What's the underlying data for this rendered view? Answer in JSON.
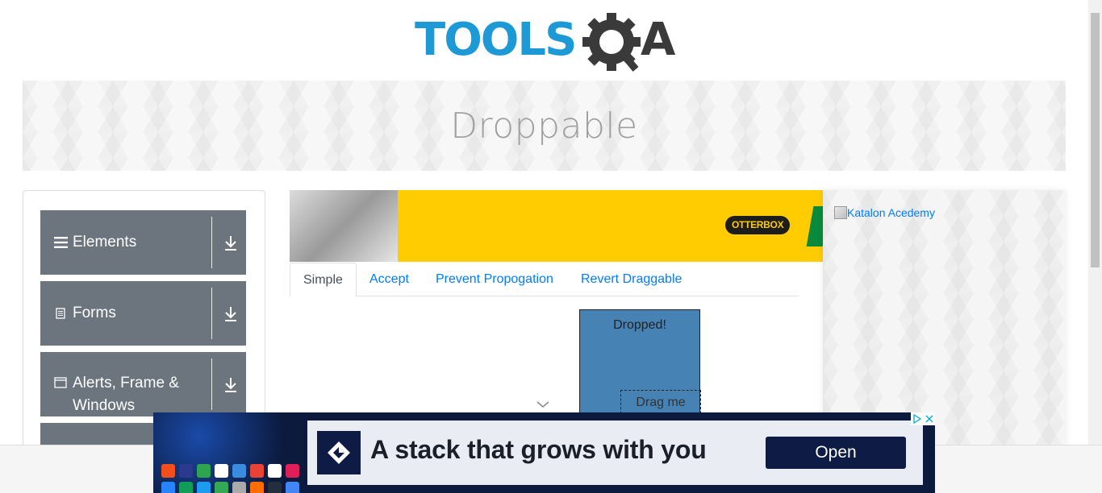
{
  "header": {
    "logo_alt": "TOOLSQA",
    "logo_text_tools": "TOOLS",
    "logo_text_qa": "A"
  },
  "banner": {
    "title": "Droppable"
  },
  "sidebar": {
    "groups": [
      {
        "label": "Elements",
        "icon": "hamburger-icon"
      },
      {
        "label": "Forms",
        "icon": "document-icon"
      },
      {
        "label_line1": "Alerts, Frame &",
        "label_line2": "Windows",
        "icon": "window-icon"
      }
    ]
  },
  "top_ad": {
    "brand": "OTTERBOX"
  },
  "tabs": [
    {
      "label": "Simple",
      "active": true
    },
    {
      "label": "Accept",
      "active": false
    },
    {
      "label": "Prevent Propogation",
      "active": false
    },
    {
      "label": "Revert Draggable",
      "active": false
    }
  ],
  "droppable": {
    "text": "Dropped!",
    "color": "#4682b4"
  },
  "draggable": {
    "text": "Drag me"
  },
  "right_ad": {
    "alt": "Katalon Acedemy"
  },
  "bottom_ad": {
    "slogan": "A stack that grows with you",
    "button": "Open"
  },
  "colors": {
    "logo_blue": "#1d9ad6",
    "logo_dark": "#3a3a3a",
    "sidebar_gray": "#6c757d",
    "link_blue": "#007bff"
  }
}
